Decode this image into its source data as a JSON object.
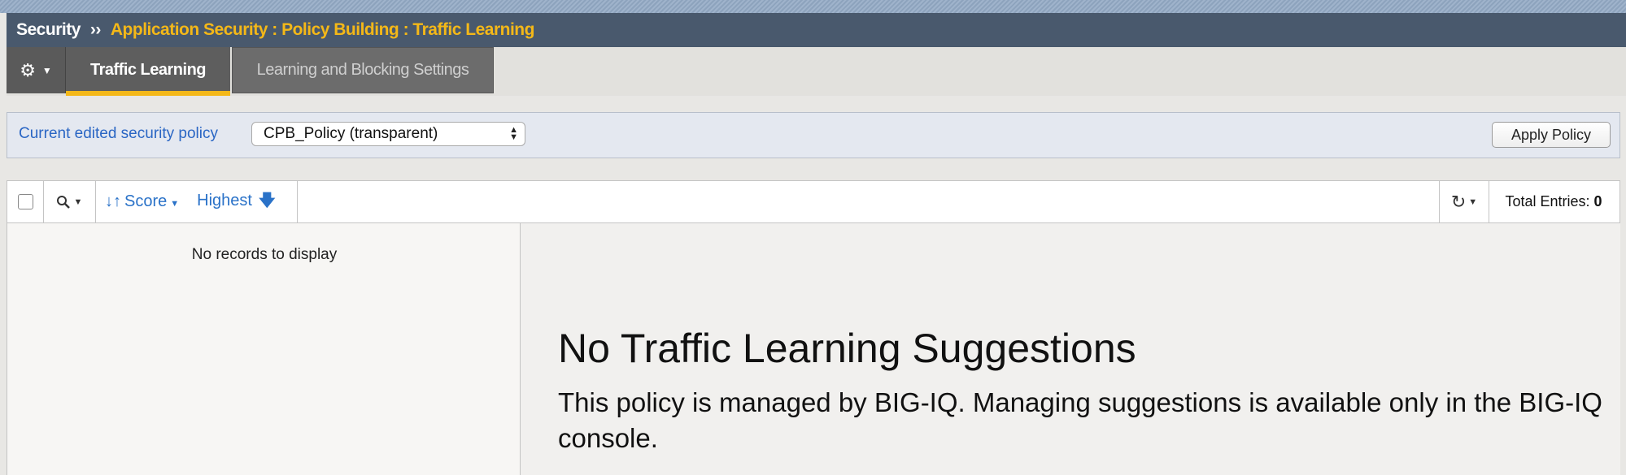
{
  "breadcrumb": {
    "root": "Security",
    "separator": "››",
    "path": "Application Security : Policy Building : Traffic Learning"
  },
  "tabs": {
    "gear_icon": "gear-icon",
    "items": [
      {
        "label": "Traffic Learning",
        "active": true
      },
      {
        "label": "Learning and Blocking Settings",
        "active": false
      }
    ]
  },
  "policy_bar": {
    "label": "Current edited security policy",
    "selected_policy": "CPB_Policy (transparent)",
    "apply_button": "Apply Policy"
  },
  "grid_toolbar": {
    "sort_label": "Score",
    "order_label": "Highest",
    "total_label": "Total Entries:",
    "total_value": "0"
  },
  "records": {
    "empty_text": "No records to display"
  },
  "detail": {
    "title": "No Traffic Learning Suggestions",
    "message": "This policy is managed by BIG-IQ. Managing suggestions is available only in the BIG-IQ console."
  },
  "colors": {
    "breadcrumb_bg": "#49596d",
    "accent_yellow": "#f4b818",
    "link_blue": "#2a72c8"
  }
}
